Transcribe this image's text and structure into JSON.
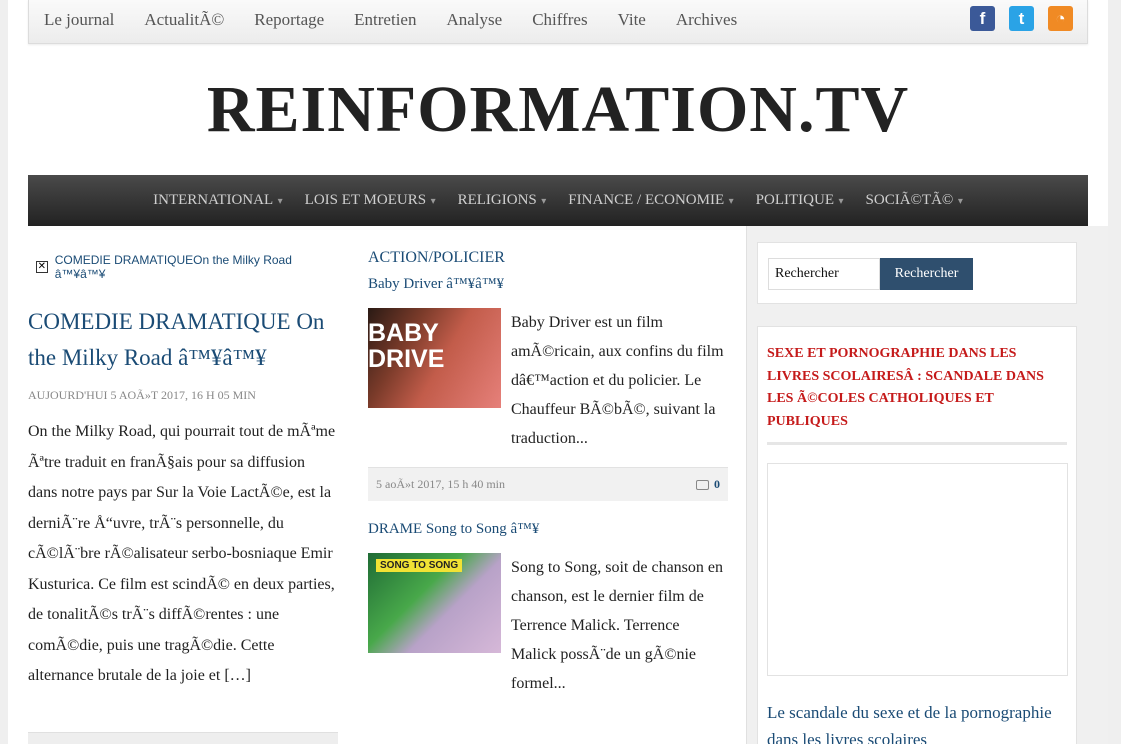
{
  "topnav": {
    "items": [
      "Le journal",
      "ActualitÃ©",
      "Reportage",
      "Entretien",
      "Analyse",
      "Chiffres",
      "Vite",
      "Archives"
    ],
    "social": [
      {
        "name": "facebook-icon",
        "glyph": "f"
      },
      {
        "name": "twitter-icon",
        "glyph": "t"
      },
      {
        "name": "rss-icon",
        "glyph": "◔"
      }
    ]
  },
  "logo": "REINFORMATION.TV",
  "mainnav": {
    "items": [
      "INTERNATIONAL",
      "LOIS ET MOEURS",
      "RELIGIONS",
      "FINANCE / ECONOMIE",
      "POLITIQUE",
      "SOCIÃ©TÃ©"
    ]
  },
  "left_article": {
    "breadcrumb": "COMEDIE DRAMATIQUEOn the Milky Road â™¥â™¥",
    "title": "COMEDIE DRAMATIQUE On the Milky Road â™¥â™¥",
    "date": "AUJOURD'HUI 5 AOÃ»T 2017, 16 H 05 MIN",
    "excerpt": "On the Milky Road, qui pourrait tout de mÃªme Ãªtre traduit en franÃ§ais pour sa diffusion dans notre pays par Sur la Voie LactÃ©e, est la derniÃ¨re Å“uvre, trÃ¨s personnelle, du cÃ©lÃ¨bre rÃ©alisateur serbo-bosniaque Emir Kusturica. Ce film est scindÃ© en deux parties, de tonalitÃ©s trÃ¨s diffÃ©rentes : une comÃ©die, puis une tragÃ©die. Cette alternance brutale de la joie et […]"
  },
  "mid_articles": [
    {
      "category": "ACTION/POLICIER",
      "title": "Baby Driver â™¥â™¥",
      "thumb_text": "BABY DRIVE",
      "excerpt": "Baby Driver est un film amÃ©ricain, aux confins du film dâ€™action et du policier. Le Chauffeur BÃ©bÃ©, suivant la traduction...",
      "date": "5 aoÃ»t 2017, 15 h 40 min",
      "comments": "0"
    },
    {
      "title": "DRAME Song to Song â™¥",
      "thumb_text": "SONG TO SONG",
      "excerpt": "Song to Song, soit de chanson en chanson, est le dernier film de Terrence Malick. Terrence Malick possÃ¨de un gÃ©nie formel..."
    }
  ],
  "sidebar": {
    "search_value": "Rechercher",
    "search_button": "Rechercher",
    "headline": "SEXE ET PORNOGRAPHIE DANS LES LIVRES SCOLAIRESÂ : SCANDALE DANS LES Ã©COLES CATHOLIQUES ET PUBLIQUES",
    "link": "Le scandale du sexe et de la pornographie dans les livres scolaires"
  }
}
